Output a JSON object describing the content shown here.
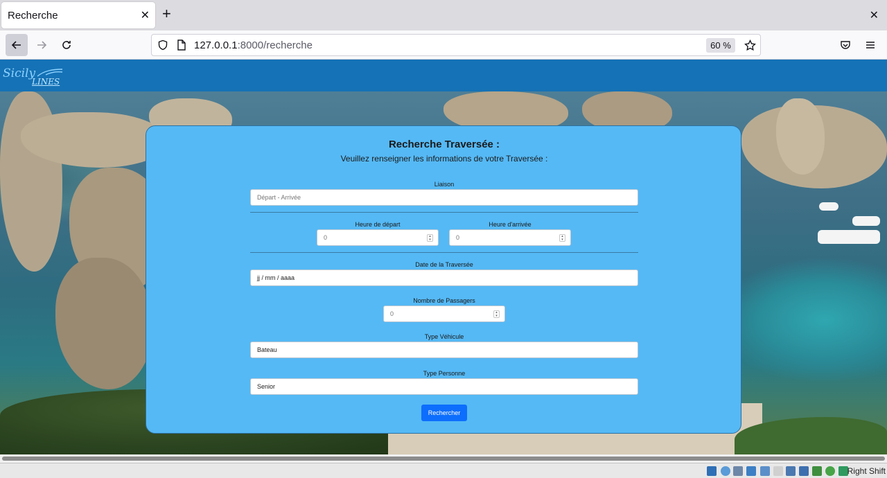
{
  "browser": {
    "tab_title": "Recherche",
    "url_host": "127.0.0.1",
    "url_path": ":8000/recherche",
    "zoom": "60 %"
  },
  "site": {
    "logo_main": "Sicily",
    "logo_sub": "LINES",
    "header_color": "#1572b6"
  },
  "form": {
    "title": "Recherche Traversée :",
    "subtitle": "Veuillez renseigner les informations de votre Traversée :",
    "liaison_label": "Liaison",
    "liaison_placeholder": "Départ - Arrivée",
    "depart_label": "Heure de départ",
    "depart_value": "0",
    "arrivee_label": "Heure d'arrivée",
    "arrivee_value": "0",
    "date_label": "Date de la Traversée",
    "date_value": "jj / mm / aaaa",
    "passagers_label": "Nombre de Passagers",
    "passagers_value": "0",
    "vehicule_label": "Type Véhicule",
    "vehicule_value": "Bateau",
    "personne_label": "Type Personne",
    "personne_value": "Senior",
    "submit_label": "Rechercher",
    "card_color": "#55b9f5",
    "button_color": "#0d6efd"
  },
  "taskbar": {
    "host_key_text": "Right Shift"
  }
}
